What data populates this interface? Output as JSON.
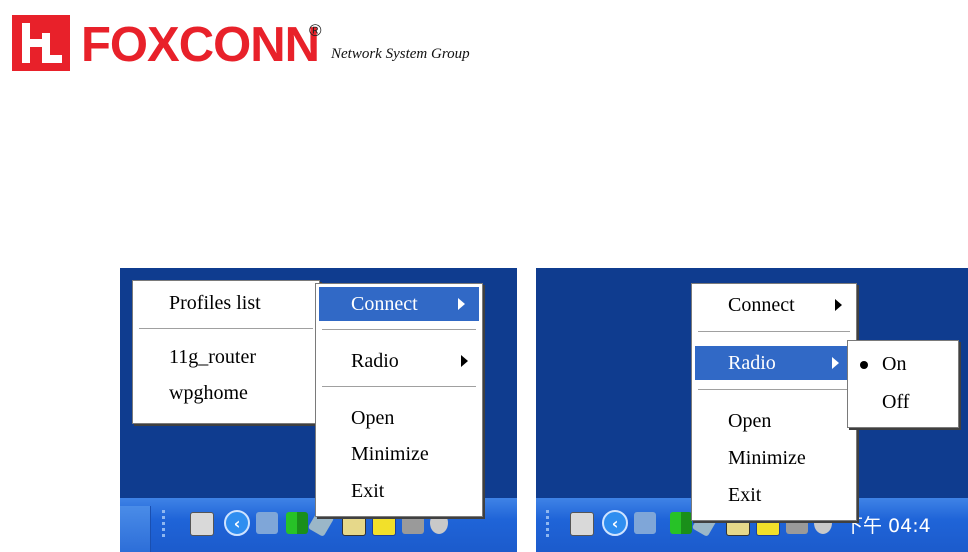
{
  "header": {
    "logo_text": "FOXCONN",
    "registered_mark": "®",
    "subtitle": "Network System Group"
  },
  "left_screenshot": {
    "profiles_menu": {
      "title": "Profiles list",
      "items": [
        "11g_router",
        "wpghome"
      ]
    },
    "main_menu": {
      "items": {
        "connect": "Connect",
        "radio": "Radio",
        "open": "Open",
        "minimize": "Minimize",
        "exit": "Exit"
      },
      "highlighted": "Connect"
    }
  },
  "right_screenshot": {
    "main_menu": {
      "items": {
        "connect": "Connect",
        "radio": "Radio",
        "open": "Open",
        "minimize": "Minimize",
        "exit": "Exit"
      },
      "highlighted": "Radio"
    },
    "radio_submenu": {
      "on": "On",
      "off": "Off",
      "selected": "On"
    },
    "clock": "下午 04:4"
  },
  "colors": {
    "brand_red": "#e8212a",
    "desktop_blue": "#0f3c8f",
    "taskbar_blue": "#1f64d8",
    "menu_highlight": "#3169c6"
  },
  "icons": [
    "keyboard-icon",
    "show-hidden-icons-chevron",
    "network-computers-icon",
    "signal-strength-icon",
    "pen-icon",
    "network-adapter-icon",
    "wireless-utility-icon",
    "printer-icon",
    "sound-icon"
  ]
}
